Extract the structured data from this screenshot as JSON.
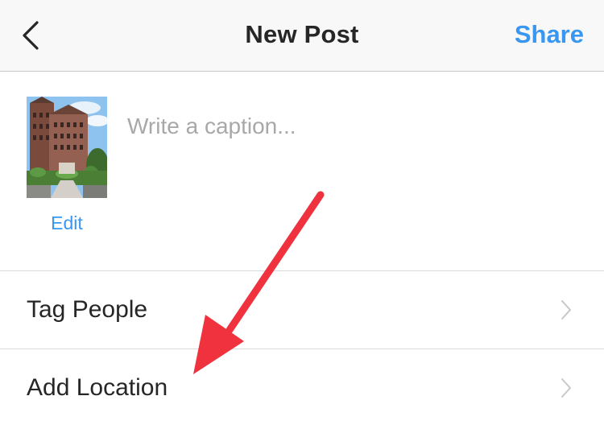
{
  "header": {
    "back_icon": "chevron-left-icon",
    "title": "New Post",
    "share_label": "Share",
    "share_color": "#3897f0"
  },
  "composer": {
    "thumbnail": "building-photo",
    "edit_label": "Edit",
    "caption_value": "",
    "caption_placeholder": "Write a caption..."
  },
  "options": [
    {
      "label": "Tag People",
      "icon": "chevron-right-icon"
    },
    {
      "label": "Add Location",
      "icon": "chevron-right-icon"
    }
  ],
  "annotation": {
    "icon": "red-arrow",
    "color": "#f0323f"
  }
}
